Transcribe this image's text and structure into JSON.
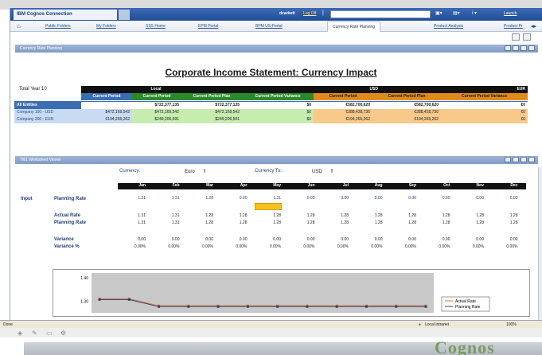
{
  "app": {
    "title": "IBM Cognos Connection",
    "user": "dcarbett",
    "logoff": "Log Off",
    "launch": "Launch",
    "separator": "|"
  },
  "tabs": [
    "Public Folders",
    "My Folders",
    "SSS Home",
    "EPM Portal",
    "BPM US Portal",
    "Currency Rate Planning",
    "Product Analysis",
    "Product Pr"
  ],
  "portlet1": {
    "title": "Currency Rate Planning"
  },
  "report": {
    "title": "Corporate Income Statement: Currency Impact",
    "total_label": "Total Year 10",
    "group_local": "Local",
    "group_usd": "USD",
    "group_eur": "EUR",
    "columns": [
      "Current Period",
      "Current Period",
      "Current Period Plan",
      "Current Period Variance",
      "Current Period",
      "Current Period Plan",
      "Current Period Variance"
    ],
    "rows": [
      {
        "name": "All Entities",
        "values": [
          "",
          "$722,377,135",
          "$722,377,135",
          "$0",
          "€582,700,620",
          "€582,700,620",
          "€0"
        ]
      },
      {
        "name": "Company 100 - USD",
        "values": [
          "$472,169,542",
          "$472,169,542",
          "$472,169,542",
          "$0",
          "€388,428,730",
          "€388,428,730",
          "€0"
        ]
      },
      {
        "name": "Company 300 - EUR",
        "values": [
          "€194,265,262",
          "$249,206,591",
          "$249,206,591",
          "$0",
          "€194,265,262",
          "€194,265,262",
          "€0"
        ]
      }
    ]
  },
  "portlet2": {
    "title": "TM1 Worksheet Viewer"
  },
  "planning": {
    "currency_label": "Currency:",
    "currency_value": "Euro",
    "currency_to_label": "Currency To:",
    "currency_to_value": "USD",
    "input_label": "Input",
    "months": [
      "Jan",
      "Feb",
      "Mar",
      "Apr",
      "May",
      "Jun",
      "Jul",
      "Aug",
      "Sep",
      "Oct",
      "Nov",
      "Dec"
    ],
    "planning_rate_label": "Planning Rate",
    "planning_rate_input": [
      "1.31",
      "1.31",
      "1.28",
      "0.00",
      "1.31",
      "0.00",
      "0.00",
      "0.00",
      "0.00",
      "0.00",
      "0.00",
      "0.00"
    ],
    "actual_rate_label": "Actual Rate",
    "actual_rate": [
      "1.31",
      "1.31",
      "1.28",
      "1.28",
      "1.28",
      "1.28",
      "1.28",
      "1.28",
      "1.28",
      "1.28",
      "1.28",
      "1.28"
    ],
    "planning_rate2_label": "Planning Rate",
    "planning_rate": [
      "1.31",
      "1.31",
      "1.28",
      "1.28",
      "1.28",
      "1.28",
      "1.28",
      "1.28",
      "1.28",
      "1.28",
      "1.28",
      "1.28"
    ],
    "variance_label": "Variance",
    "variance": [
      "0.00",
      "0.00",
      "0.00",
      "0.00",
      "0.00",
      "0.00",
      "0.00",
      "0.00",
      "0.00",
      "0.00",
      "0.00",
      "0.00"
    ],
    "variance_pct_label": "Variance %",
    "variance_pct": [
      "0.00%",
      "0.00%",
      "0.00%",
      "0.00%",
      "0.00%",
      "0.00%",
      "0.00%",
      "0.00%",
      "0.00%",
      "0.00%",
      "0.00%",
      "0.00%"
    ]
  },
  "chart_data": {
    "type": "line",
    "x": [
      "Jan",
      "Feb",
      "Mar",
      "Apr",
      "May",
      "Jun",
      "Jul",
      "Aug",
      "Sep",
      "Oct",
      "Nov",
      "Dec"
    ],
    "yticks": [
      "1.40",
      "1.30"
    ],
    "ylim": [
      1.25,
      1.42
    ],
    "series": [
      {
        "name": "Actual Rate",
        "color": "#e07a3a",
        "values": [
          1.31,
          1.31,
          1.28,
          1.28,
          1.28,
          1.28,
          1.28,
          1.28,
          1.28,
          1.28,
          1.28,
          1.28
        ]
      },
      {
        "name": "Planning Rate",
        "color": "#2a3f7a",
        "values": [
          1.31,
          1.31,
          1.28,
          1.28,
          1.28,
          1.28,
          1.28,
          1.28,
          1.28,
          1.28,
          1.28,
          1.28
        ]
      }
    ],
    "legend_position": "bottom-right"
  },
  "status": {
    "left": "Done",
    "zone": "Local intranet",
    "zoom": "100%"
  },
  "brand": "Cognos",
  "colors": {
    "title_bar": "#1f4c96",
    "local_header": "#3b6db3",
    "usd_header": "#2a8a2a",
    "eur_header": "#e08a1a",
    "local_row": "#c9dbf2",
    "usd_row": "#c6ecb0",
    "eur_row": "#f9c98a"
  }
}
